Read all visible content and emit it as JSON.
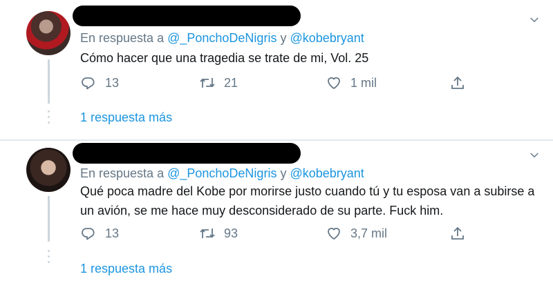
{
  "tweets": [
    {
      "reply_prefix": "En respuesta a",
      "mention_1": "@_PonchoDeNigris",
      "conjunction": "y",
      "mention_2": "@kobebryant",
      "text": "Cómo hacer que una tragedia se trate de mi, Vol. 25",
      "reply_count": "13",
      "retweet_count": "21",
      "like_count": "1 mil",
      "more_replies": "1 respuesta más"
    },
    {
      "reply_prefix": "En respuesta a",
      "mention_1": "@_PonchoDeNigris",
      "conjunction": "y",
      "mention_2": "@kobebryant",
      "text": "Qué poca madre del Kobe por morirse justo cuando tú y tu esposa van a subirse a un avión, se me hace muy desconsiderado de su parte. Fuck him.",
      "reply_count": "13",
      "retweet_count": "93",
      "like_count": "3,7 mil",
      "more_replies": "1 respuesta más"
    }
  ],
  "icons": {
    "reply": "reply-icon",
    "retweet": "retweet-icon",
    "like": "heart-icon",
    "share": "share-icon",
    "menu": "chevron-down-icon"
  },
  "colors": {
    "link": "#1b95e0",
    "muted": "#657786",
    "text": "#14171a",
    "divider": "#e1e8ed"
  }
}
